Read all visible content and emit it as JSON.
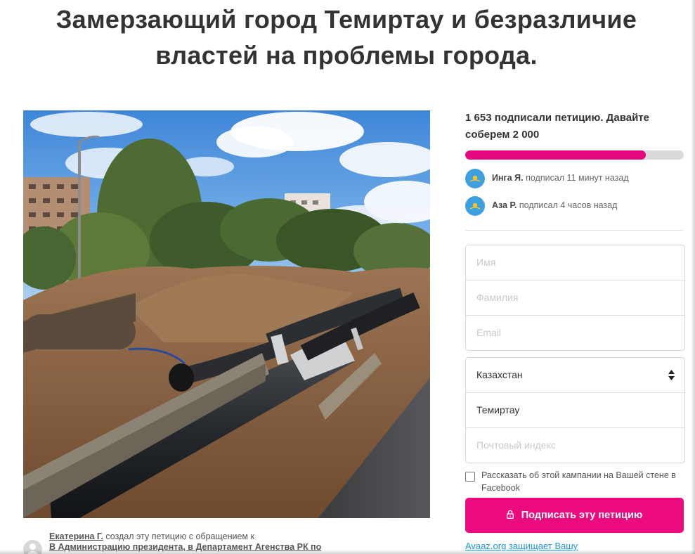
{
  "title_line1": "Замерзающий город Темиртау и безразличие",
  "title_line2": "властей на проблемы города.",
  "photo": {
    "description_icon": "petition-photo"
  },
  "creator": {
    "name": "Екатерина Г.",
    "text": " создал эту петицию с обращением к",
    "targets": "В Администрацию президента, в Департамент Агенства РК по"
  },
  "counter": {
    "text": "1 653 подписали петицию. Давайте соберем 2 000",
    "signed": 1653,
    "goal": 2000
  },
  "colors": {
    "accent": "#ec0b7f",
    "flag_blue": "#3fa0e0",
    "flag_gold": "#f2c230",
    "link": "#1a9ad7"
  },
  "signers": [
    {
      "name": "Инга Я.",
      "action": " подписал 11 минут назад",
      "icon": "kazakhstan-flag-icon"
    },
    {
      "name": "Аза Р.",
      "action": " подписал 4 часов назад",
      "icon": "kazakhstan-flag-icon"
    }
  ],
  "form": {
    "first_name_placeholder": "Имя",
    "last_name_placeholder": "Фамилия",
    "email_placeholder": "Email",
    "country": "Казахстан",
    "city": "Темиртау",
    "postal_placeholder": "Почтовый индекс"
  },
  "share_label": "Рассказать об этой кампании на Вашей стене в Facebook",
  "sign_button": "Подписать эту петицию",
  "privacy_text": "Avaaz.org защищает Вашу"
}
